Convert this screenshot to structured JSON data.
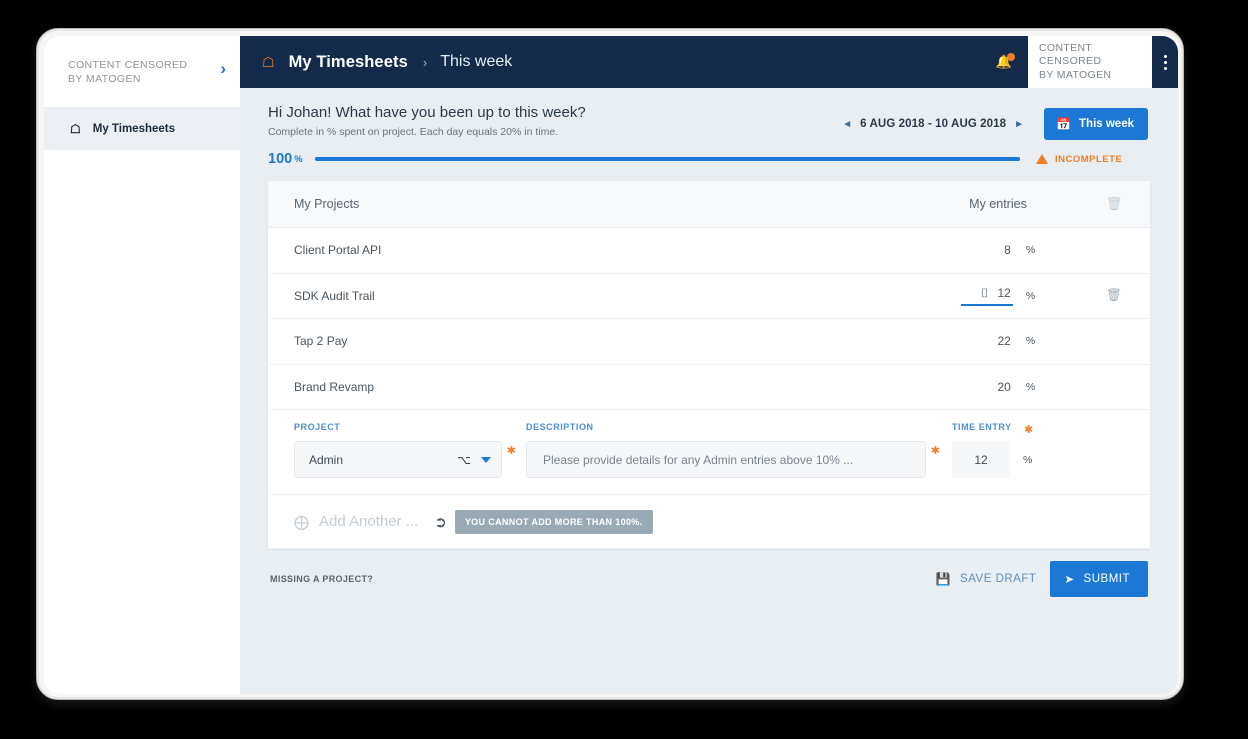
{
  "sidebar": {
    "brand": "CONTENT CENSORED\nBY MATOGEN",
    "expand_icon": "chevron-right-icon",
    "items": [
      {
        "label": "My Timesheets",
        "icon": "home-icon"
      }
    ]
  },
  "topbar": {
    "home_icon": "home-icon",
    "breadcrumb_main": "My Timesheets",
    "breadcrumb_sep": "›",
    "breadcrumb_sub": "This week",
    "bell_icon": "bell-icon",
    "user": "CONTENT CENSORED\nBY MATOGEN",
    "kebab_icon": "more-vertical-icon"
  },
  "greeting": {
    "title": "Hi Johan! What have you been up to this week?",
    "subtitle": "Complete in % spent on project. Each day equals 20% in time.",
    "prev_icon": "◄",
    "date_range": "6 AUG 2018 - 10 AUG 2018",
    "next_icon": "►",
    "week_button": "This week",
    "calendar_icon": "calendar-icon"
  },
  "progress": {
    "percent_number": "100",
    "percent_sign": "%",
    "fill_pct": 100,
    "status": "INCOMPLETE",
    "status_icon": "warning-triangle-icon",
    "bar_color": "#1b78d4",
    "status_color": "#f07d28"
  },
  "table": {
    "header": {
      "projects": "My Projects",
      "entries": "My entries",
      "action_icon": "trash-list-icon"
    },
    "rows": [
      {
        "name": "Client Portal API",
        "value": "8",
        "unit": "%",
        "active": false,
        "deletable": false
      },
      {
        "name": "SDK Audit Trail",
        "value": "12",
        "unit": "%",
        "active": true,
        "deletable": true
      },
      {
        "name": "Tap 2 Pay",
        "value": "22",
        "unit": "%",
        "active": false,
        "deletable": false
      },
      {
        "name": "Brand Revamp",
        "value": "20",
        "unit": "%",
        "active": false,
        "deletable": false
      }
    ],
    "row_delete_icon": "trash-icon",
    "caret_icon": "text-cursor-icon"
  },
  "form": {
    "project_label": "PROJECT",
    "project_value": "Admin",
    "description_label": "DESCRIPTION",
    "description_placeholder": "Please provide details for any Admin entries above 10% ...",
    "time_label": "TIME ENTRY",
    "time_value": "12",
    "time_unit": "%",
    "required_mark": "✱",
    "dropdown_icon": "chevron-down-icon"
  },
  "add_another": {
    "icon": "add-circle-icon",
    "label": "Add Another ...",
    "cursor_icon": "mouse-pointer-icon",
    "tooltip": "YOU CANNOT ADD MORE THAN 100%."
  },
  "footer": {
    "missing_project": "MISSING A PROJECT?",
    "save_draft": "SAVE DRAFT",
    "save_icon": "save-icon",
    "submit": "SUBMIT",
    "submit_icon": "send-icon"
  },
  "theme": {
    "navy": "#132a4a",
    "blue": "#1b78d4",
    "orange": "#f07d28",
    "page_bg": "#e9eef2"
  }
}
